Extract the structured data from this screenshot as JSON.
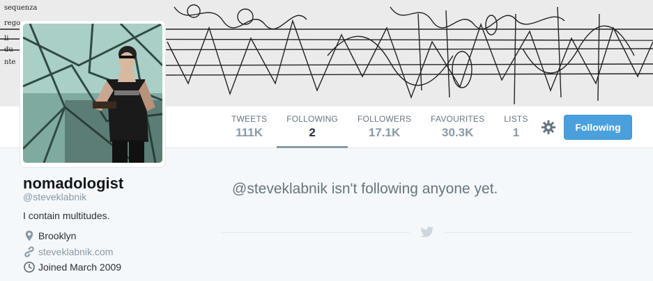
{
  "nav": {
    "items": [
      {
        "label": "TWEETS",
        "value": "111K",
        "active": false
      },
      {
        "label": "FOLLOWING",
        "value": "2",
        "active": true
      },
      {
        "label": "FOLLOWERS",
        "value": "17.1K",
        "active": false
      },
      {
        "label": "FAVOURITES",
        "value": "30.3K",
        "active": false
      },
      {
        "label": "LISTS",
        "value": "1",
        "active": false
      }
    ],
    "gear_icon": "gear-icon",
    "follow_button": "Following"
  },
  "profile": {
    "name": "nomadologist",
    "handle": "@steveklabnik",
    "bio": "I contain multitudes.",
    "location": "Brooklyn",
    "website": "steveklabnik.com",
    "joined": "Joined March 2009",
    "icons": {
      "location": "location-pin-icon",
      "website": "link-icon",
      "joined": "clock-icon"
    }
  },
  "main": {
    "empty_message": "@steveklabnik isn't following anyone yet.",
    "divider_icon": "bird-icon"
  },
  "colors": {
    "accent": "#4aa0dd",
    "page_bg": "#f5f8fa",
    "muted": "#8899a6"
  }
}
